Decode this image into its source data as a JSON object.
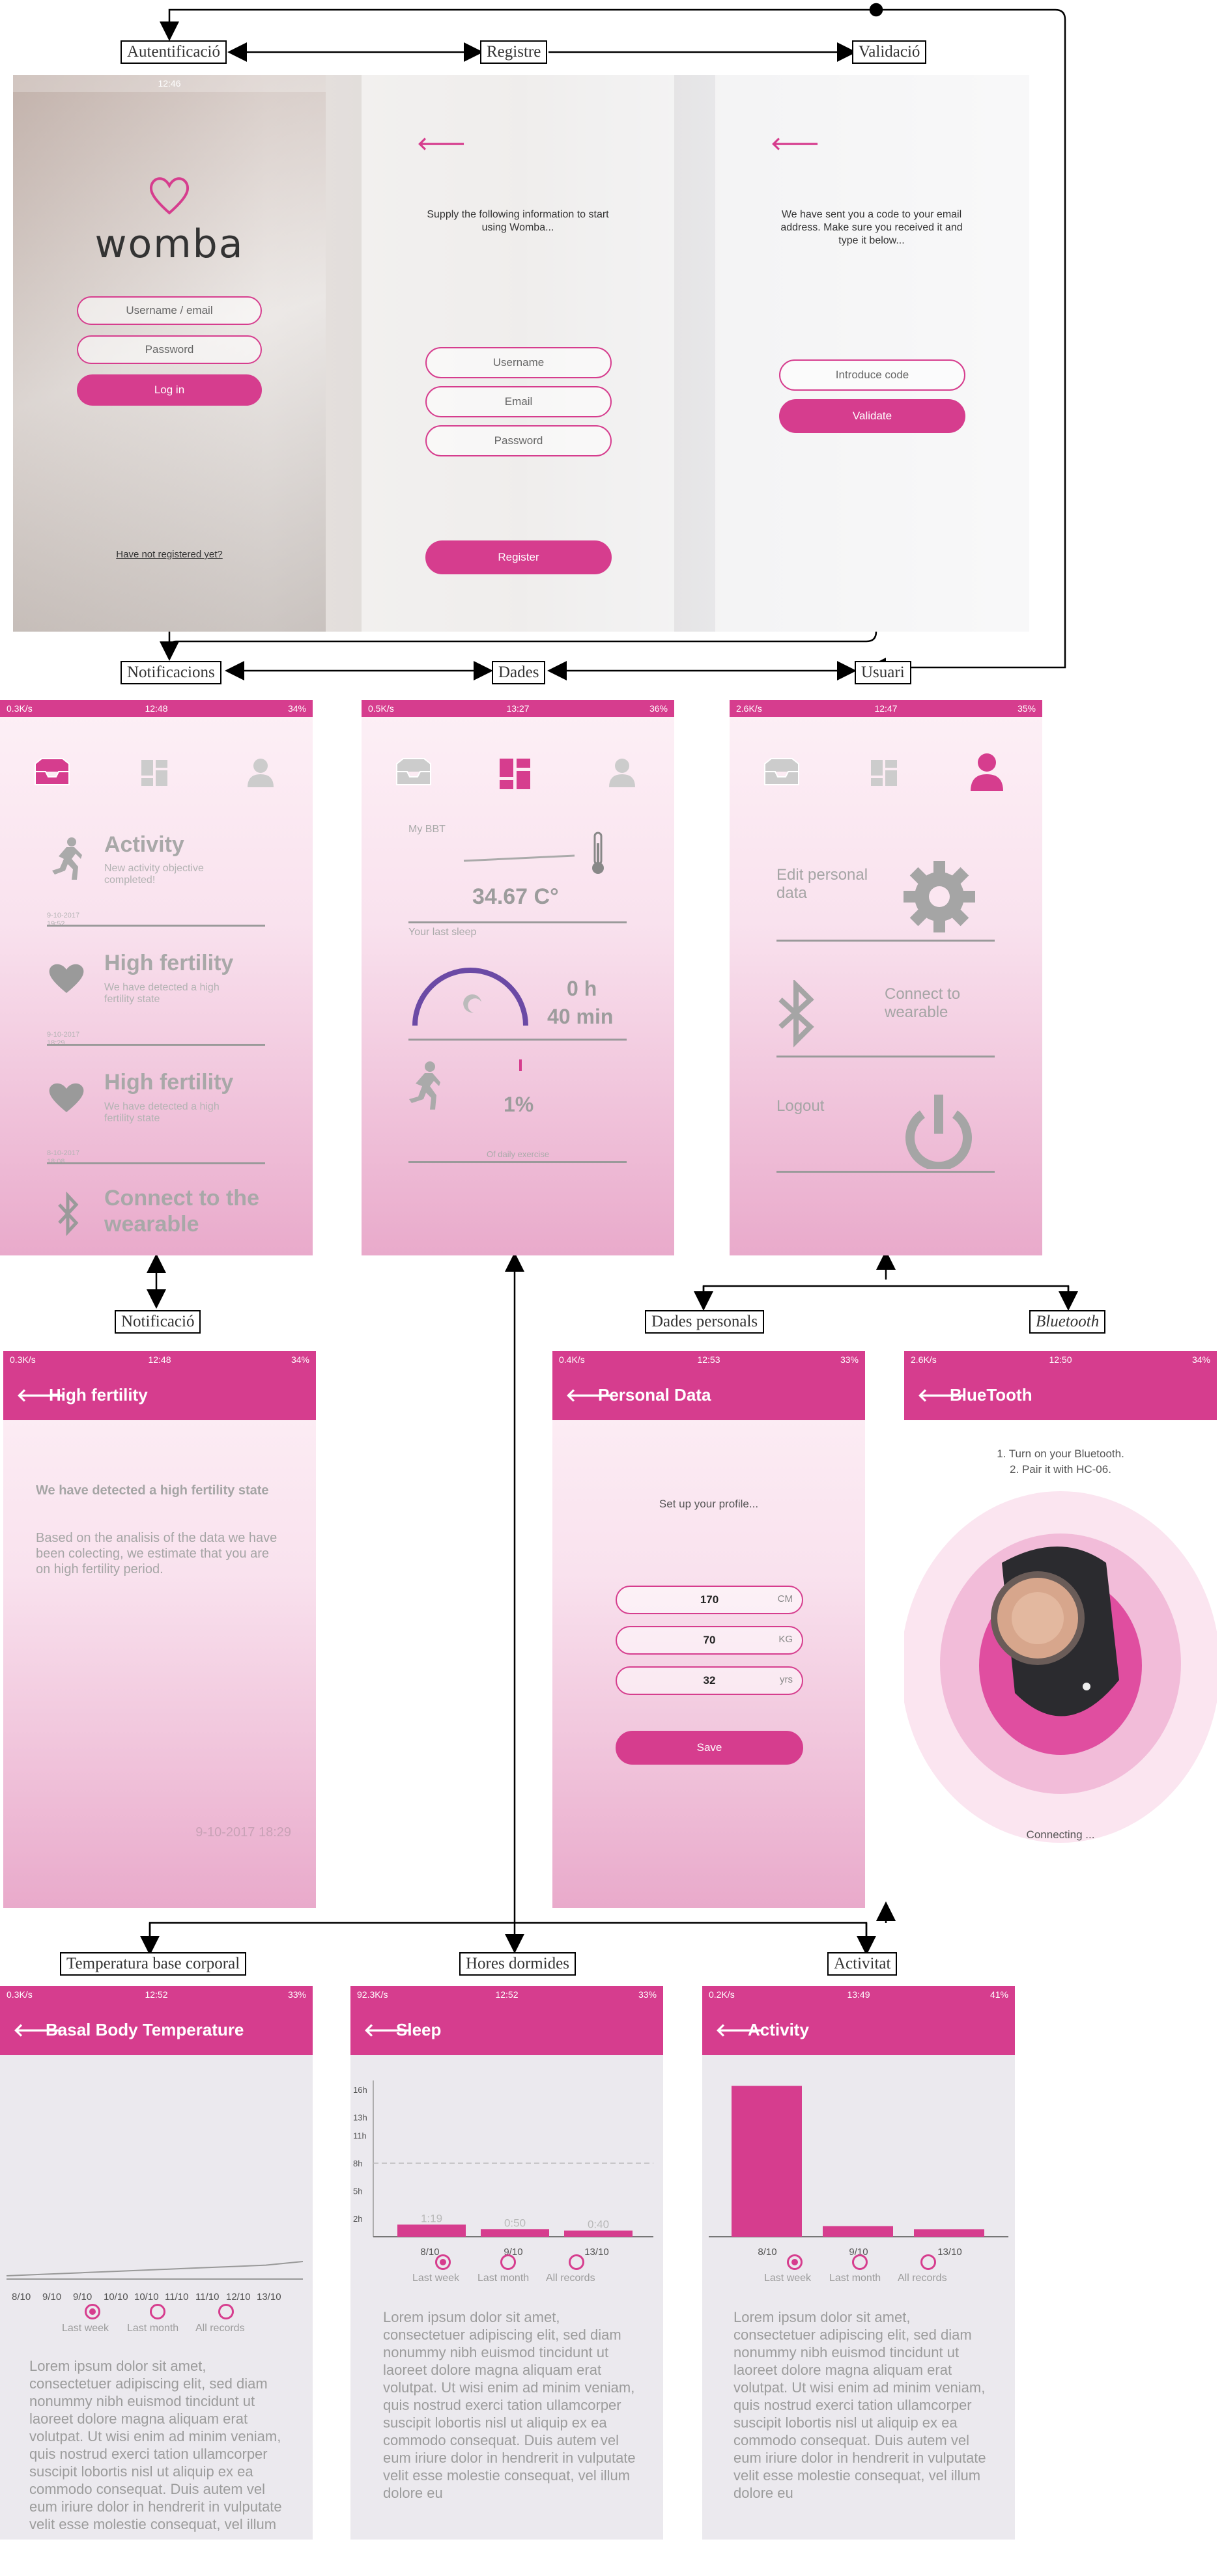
{
  "nodes": {
    "autentificacio": "Autentificació",
    "registre": "Registre",
    "validacio": "Validació",
    "notificacions": "Notificacions",
    "dades": "Dades",
    "usuari": "Usuari",
    "notificacio": "Notificació",
    "dades_personals": "Dades personals",
    "bluetooth": "Bluetooth",
    "temperatura": "Temperatura base corporal",
    "hores": "Hores dormides",
    "activitat": "Activitat"
  },
  "login": {
    "time": "12:46",
    "logo": "womba",
    "username_placeholder": "Username / email",
    "password_placeholder": "Password",
    "login_button": "Log in",
    "register_link": "Have not registered yet?"
  },
  "register": {
    "intro": "Supply the following information to start using Womba...",
    "username": "Username",
    "email": "Email",
    "password": "Password",
    "button": "Register"
  },
  "validate": {
    "intro": "We have sent you a code to your email address. Make sure you received it and type it below...",
    "code_placeholder": "Introduce code",
    "button": "Validate"
  },
  "notifications_screen": {
    "status": {
      "left": "0.3K/s",
      "time": "12:48",
      "right": "34%"
    },
    "items": [
      {
        "title": "Activity",
        "sub": "New activity objective completed!",
        "date": "9-10-2017\n19:52",
        "icon": "running-icon"
      },
      {
        "title": "High fertility",
        "sub": "We have detected a high fertility state",
        "date": "9-10-2017\n18:29",
        "icon": "heart-icon"
      },
      {
        "title": "High fertility",
        "sub": "We have detected a high fertility state",
        "date": "8-10-2017\n18:08",
        "icon": "heart-icon"
      },
      {
        "title": "Connect to the wearable",
        "sub": "",
        "date": "",
        "icon": "bluetooth-icon"
      }
    ]
  },
  "data_screen": {
    "status": {
      "left": "0.5K/s",
      "time": "13:27",
      "right": "36%"
    },
    "bbt_label": "My BBT",
    "bbt_value": "34.67 C°",
    "sleep_label": "Your last sleep",
    "sleep_hours": "0 h",
    "sleep_min": "40 min",
    "activity_value": "1%",
    "activity_caption": "Of daily exercise"
  },
  "user_screen": {
    "status": {
      "left": "2.6K/s",
      "time": "12:47",
      "right": "35%"
    },
    "edit": "Edit personal data",
    "connect": "Connect to wearable",
    "logout": "Logout"
  },
  "notification_detail": {
    "status": {
      "left": "0.3K/s",
      "time": "12:48",
      "right": "34%"
    },
    "title": "High fertility",
    "heading": "We have detected a high fertility state",
    "body": "Based on the analisis of the data we have been colecting, we estimate that you are on high fertility period.",
    "date": "9-10-2017 18:29"
  },
  "personal_data": {
    "status": {
      "left": "0.4K/s",
      "time": "12:53",
      "right": "33%"
    },
    "title": "Personal Data",
    "intro": "Set up your profile...",
    "fields": [
      {
        "value": "170",
        "unit": "CM"
      },
      {
        "value": "70",
        "unit": "KG"
      },
      {
        "value": "32",
        "unit": "yrs"
      }
    ],
    "button": "Save"
  },
  "bluetooth_screen": {
    "status": {
      "left": "2.6K/s",
      "time": "12:50",
      "right": "34%"
    },
    "title": "BlueTooth",
    "step1": "1. Turn on your Bluetooth.",
    "step2": "2. Pair it with HC-06.",
    "connecting": "Connecting ..."
  },
  "bbt_screen": {
    "status": {
      "left": "0.3K/s",
      "time": "12:52",
      "right": "33%"
    },
    "title": "Basal Body Temperature",
    "options": [
      "Last week",
      "Last month",
      "All records"
    ]
  },
  "sleep_screen": {
    "status": {
      "left": "92.3K/s",
      "time": "12:52",
      "right": "33%"
    },
    "title": "Sleep",
    "options": [
      "Last week",
      "Last month",
      "All records"
    ]
  },
  "activity_screen": {
    "status": {
      "left": "0.2K/s",
      "time": "13:49",
      "right": "41%"
    },
    "title": "Activity",
    "options": [
      "Last week",
      "Last month",
      "All records"
    ]
  },
  "lorem": "Lorem ipsum dolor sit amet, consectetuer adipiscing elit, sed diam nonummy nibh euismod tincidunt ut laoreet dolore magna aliquam erat volutpat. Ut wisi enim ad minim veniam, quis nostrud exerci tation ullamcorper suscipit lobortis nisl ut aliquip ex ea commodo consequat. Duis autem vel eum iriure dolor in hendrerit in vulputate velit esse molestie consequat, vel illum dolore eu",
  "chart_data": [
    {
      "type": "line",
      "title": "Basal Body Temperature",
      "categories": [
        "8/10",
        "9/10",
        "9/10",
        "10/10",
        "10/10",
        "11/10",
        "11/10",
        "12/10",
        "13/10"
      ],
      "values": [
        34.2,
        34.25,
        34.3,
        34.35,
        34.4,
        34.45,
        34.5,
        34.55,
        34.67
      ]
    },
    {
      "type": "bar",
      "title": "Sleep",
      "categories": [
        "8/10",
        "9/10",
        "13/10"
      ],
      "values": [
        1.32,
        0.83,
        0.67
      ],
      "data_labels": [
        "1:19",
        "0:50",
        "0:40"
      ],
      "y_ticks": [
        "16h",
        "13h",
        "11h",
        "8h",
        "5h",
        "2h"
      ],
      "ylim": [
        0,
        17
      ],
      "target_line": 8
    },
    {
      "type": "bar",
      "title": "Activity",
      "categories": [
        "8/10",
        "9/10",
        "13/10"
      ],
      "values": [
        100,
        7,
        5
      ],
      "ylim": [
        0,
        110
      ]
    }
  ],
  "colors": {
    "accent": "#d63d8e",
    "purple": "#6b4aa5"
  }
}
